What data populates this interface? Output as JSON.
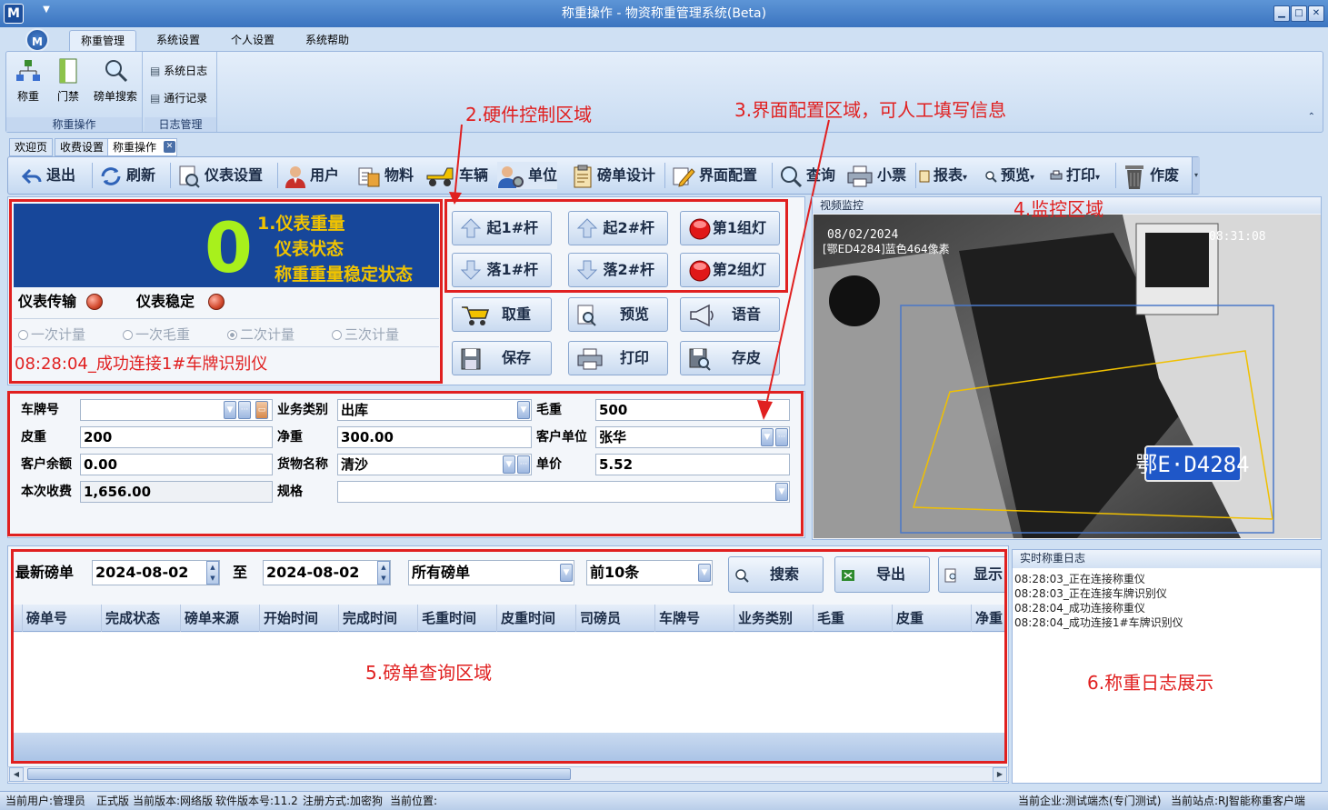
{
  "window": {
    "title": "称重操作 - 物资称重管理系统(Beta)",
    "app_icon_letter": "M",
    "orb_letter": "M"
  },
  "ribbon_tabs": [
    {
      "label": "称重管理",
      "active": true
    },
    {
      "label": "系统设置",
      "active": false
    },
    {
      "label": "个人设置",
      "active": false
    },
    {
      "label": "系统帮助",
      "active": false
    }
  ],
  "ribbon": {
    "weigh_group": {
      "label": "称重操作",
      "buttons": [
        "称重",
        "门禁",
        "磅单搜索"
      ]
    },
    "log_group": {
      "label": "日志管理",
      "items": [
        "系统日志",
        "通行记录"
      ]
    }
  },
  "doc_tabs": [
    "欢迎页",
    "收费设置",
    "称重操作"
  ],
  "toolbar": [
    {
      "label": "退出",
      "icon": "exit-icon"
    },
    {
      "label": "刷新",
      "icon": "refresh-icon"
    },
    {
      "label": "仪表设置",
      "icon": "meter-settings-icon"
    },
    {
      "label": "用户",
      "icon": "user-icon"
    },
    {
      "label": "物料",
      "icon": "material-icon"
    },
    {
      "label": "车辆",
      "icon": "vehicle-icon"
    },
    {
      "label": "单位",
      "icon": "unit-icon"
    },
    {
      "label": "磅单设计",
      "icon": "ticket-design-icon"
    },
    {
      "label": "界面配置",
      "icon": "ui-config-icon"
    },
    {
      "label": "查询",
      "icon": "search-icon"
    },
    {
      "label": "小票",
      "icon": "printer-icon"
    },
    {
      "label": "报表",
      "icon": "report-icon"
    },
    {
      "label": "预览",
      "icon": "preview-icon"
    },
    {
      "label": "打印",
      "icon": "print-icon"
    },
    {
      "label": "作废",
      "icon": "trash-icon"
    }
  ],
  "weight": {
    "value": "0",
    "notes": [
      "1.仪表重量",
      "仪表状态",
      "称重重量稳定状态"
    ],
    "transmit_label": "仪表传输",
    "stable_label": "仪表稳定",
    "modes": [
      "一次计量",
      "一次毛重",
      "二次计量",
      "三次计量"
    ],
    "selected_mode": "二次计量",
    "message": "08:28:04_成功连接1#车牌识别仪"
  },
  "hardware": {
    "annotation": "2.硬件控制区域",
    "buttons": [
      "起1#杆",
      "起2#杆",
      "第1组灯",
      "落1#杆",
      "落2#杆",
      "第2组灯",
      "取重",
      "预览",
      "语音",
      "保存",
      "打印",
      "存皮"
    ]
  },
  "form": {
    "annotation": "3.界面配置区域，可人工填写信息",
    "plate_label": "车牌号",
    "plate_value": "",
    "business_label": "业务类别",
    "business_value": "出库",
    "gross_label": "毛重",
    "gross_value": "500",
    "tare_label": "皮重",
    "tare_value": "200",
    "net_label": "净重",
    "net_value": "300.00",
    "customer_label": "客户单位",
    "customer_value": "张华",
    "balance_label": "客户余额",
    "balance_value": "0.00",
    "goods_label": "货物名称",
    "goods_value": "清沙",
    "price_label": "单价",
    "price_value": "5.52",
    "fee_label": "本次收费",
    "fee_value": "1,656.00",
    "spec_label": "规格",
    "spec_value": ""
  },
  "monitor": {
    "header": "视频监控",
    "annotation": "4.监控区域",
    "osd_date": "08/02/2024",
    "osd_time": "08:31:08",
    "osd_plate_info": "[鄂ED4284]蓝色464像素",
    "plate_text": "鄂E·D4284"
  },
  "query": {
    "label": "最新磅单",
    "date_from": "2024-08-02",
    "to_label": "至",
    "date_to": "2024-08-02",
    "ticket_filter": "所有磅单",
    "count_filter": "前10条",
    "search_btn": "搜索",
    "export_btn": "导出",
    "show_btn": "显示",
    "annotation": "5.磅单查询区域",
    "columns": [
      "磅单号",
      "完成状态",
      "磅单来源",
      "开始时间",
      "完成时间",
      "毛重时间",
      "皮重时间",
      "司磅员",
      "车牌号",
      "业务类别",
      "毛重",
      "皮重",
      "净重"
    ]
  },
  "log": {
    "header": "实时称重日志",
    "annotation": "6.称重日志展示",
    "lines": [
      "08:28:03_正在连接称重仪",
      "08:28:03_正在连接车牌识别仪",
      "08:28:04_成功连接称重仪",
      "08:28:04_成功连接1#车牌识别仪"
    ]
  },
  "status": {
    "user": "当前用户:管理员",
    "edition": "正式版",
    "version": "当前版本:网络版",
    "software_version": "软件版本号:11.2",
    "register": "注册方式:加密狗",
    "location": "当前位置:",
    "company": "当前企业:测试端杰(专门测试)",
    "site": "当前站点:RJ智能称重客户端"
  },
  "colors": {
    "accent": "#17479a",
    "annotation_red": "#e02020",
    "weight_green": "#a8f01c",
    "note_yellow": "#f0c300"
  }
}
